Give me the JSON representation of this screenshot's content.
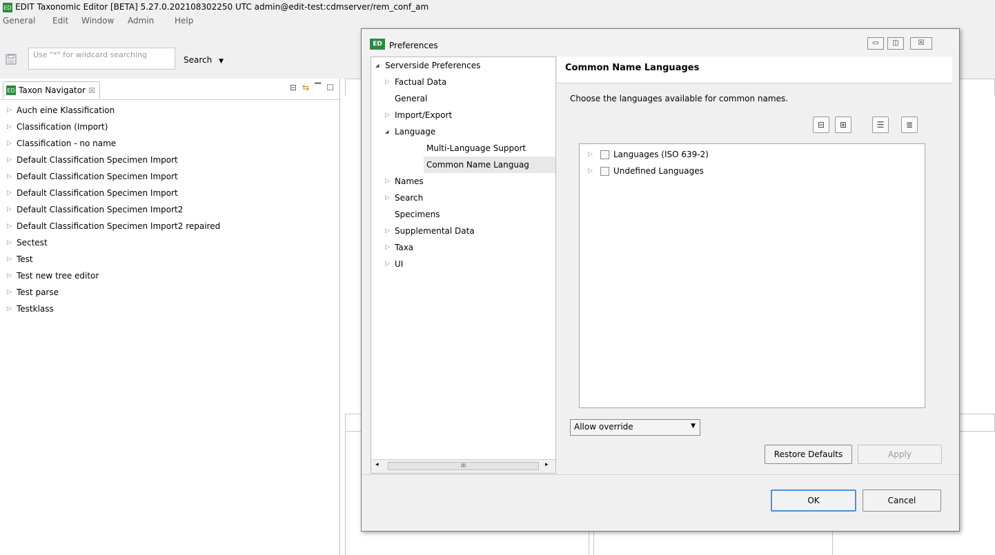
{
  "window": {
    "title": "EDIT Taxonomic Editor [BETA] 5.27.0.202108302250 UTC admin@edit-test:cdmserver/rem_conf_am",
    "icon": "edit-app-icon"
  },
  "menubar": {
    "items": [
      "General",
      "Edit",
      "Window",
      "Admin",
      "Help"
    ]
  },
  "toolbar": {
    "search_placeholder": "Use \"*\" for wildcard searching",
    "search_label": "Search",
    "search_arrow": "▼"
  },
  "navigator": {
    "tab_label": "Taxon Navigator",
    "tab_close": "☒",
    "items": [
      "Auch eine Klassification",
      "Classification (Import)",
      "Classification - no name",
      "Default Classification Specimen Import",
      "Default Classification Specimen Import",
      "Default Classification Specimen Import",
      "Default Classification Specimen Import2",
      "Default Classification Specimen Import2 repaired",
      "Sectest",
      "Test",
      "Test new tree editor",
      "Test parse",
      "Testklass"
    ]
  },
  "dialog": {
    "title": "Preferences",
    "icon_text": "ED",
    "tree": [
      {
        "label": "Serverside Preferences",
        "indent": 0,
        "arrow": "◢"
      },
      {
        "label": "Factual Data",
        "indent": 1,
        "arrow": "▷"
      },
      {
        "label": "General",
        "indent": 1,
        "arrow": ""
      },
      {
        "label": "Import/Export",
        "indent": 1,
        "arrow": "▷"
      },
      {
        "label": "Language",
        "indent": 1,
        "arrow": "◢"
      },
      {
        "label": "Multi-Language Support",
        "indent": 2,
        "arrow": ""
      },
      {
        "label": "Common Name Languag",
        "indent": 2,
        "arrow": "",
        "selected": true
      },
      {
        "label": "Names",
        "indent": 1,
        "arrow": "▷"
      },
      {
        "label": "Search",
        "indent": 1,
        "arrow": "▷"
      },
      {
        "label": "Specimens",
        "indent": 1,
        "arrow": ""
      },
      {
        "label": "Supplemental Data",
        "indent": 1,
        "arrow": "▷"
      },
      {
        "label": "Taxa",
        "indent": 1,
        "arrow": "▷"
      },
      {
        "label": "UI",
        "indent": 1,
        "arrow": "▷"
      }
    ],
    "scroll_thumb": "III",
    "page": {
      "title": "Common Name Languages",
      "description": "Choose the languages available for common names.",
      "languages": [
        "Languages (ISO 639-2)",
        "Undefined Languages"
      ],
      "override_value": "Allow override",
      "restore_label": "Restore Defaults",
      "apply_label": "Apply"
    },
    "ok_label": "OK",
    "cancel_label": "Cancel"
  }
}
